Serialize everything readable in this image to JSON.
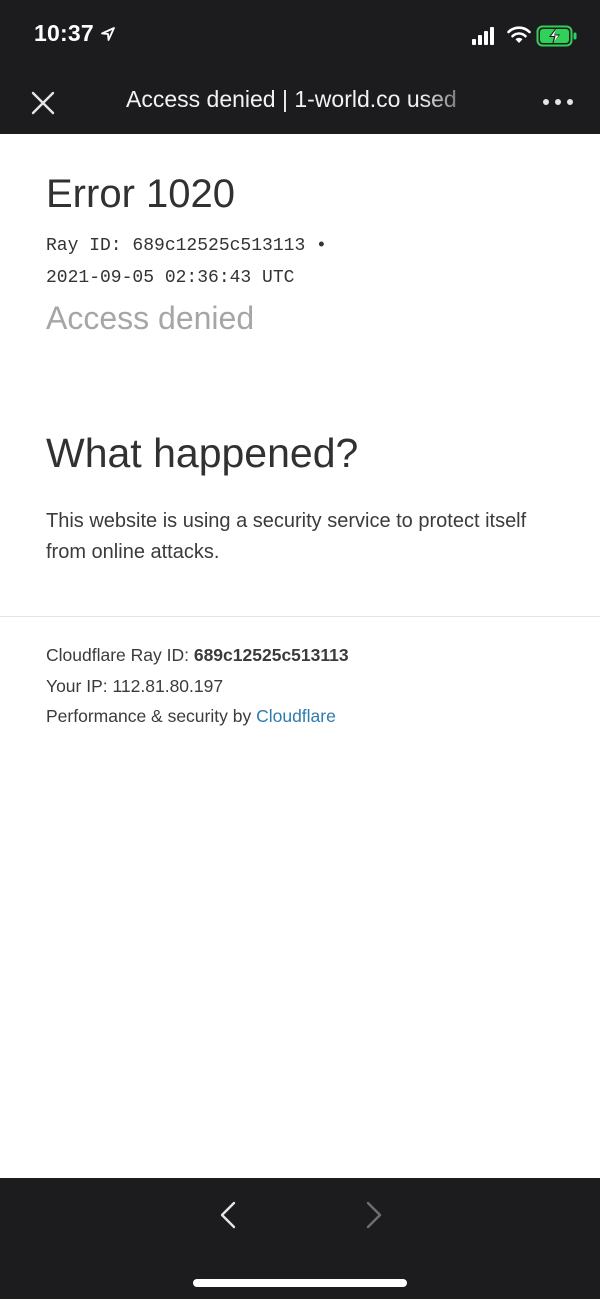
{
  "status_bar": {
    "time": "10:37",
    "icons": [
      "location-arrow-icon",
      "cellular-signal-icon",
      "wifi-icon",
      "battery-charging-icon"
    ],
    "battery_color": "#30d158"
  },
  "browser": {
    "page_title": "Access denied | 1-world.co used"
  },
  "error": {
    "title": "Error 1020",
    "ray_line1": "Ray ID: 689c12525c513113 •",
    "ray_line2": "2021-09-05 02:36:43 UTC",
    "subtitle": "Access denied"
  },
  "what_happened": {
    "heading": "What happened?",
    "text": "This website is using a security service to protect itself from online attacks."
  },
  "footer": {
    "ray_label": "Cloudflare Ray ID: ",
    "ray_value": "689c12525c513113",
    "ip_label": "Your IP: ",
    "ip_value": "112.81.80.197",
    "perf_label": "Performance & security by ",
    "cloudflare_link": "Cloudflare",
    "link_color": "#2c7cb0"
  }
}
